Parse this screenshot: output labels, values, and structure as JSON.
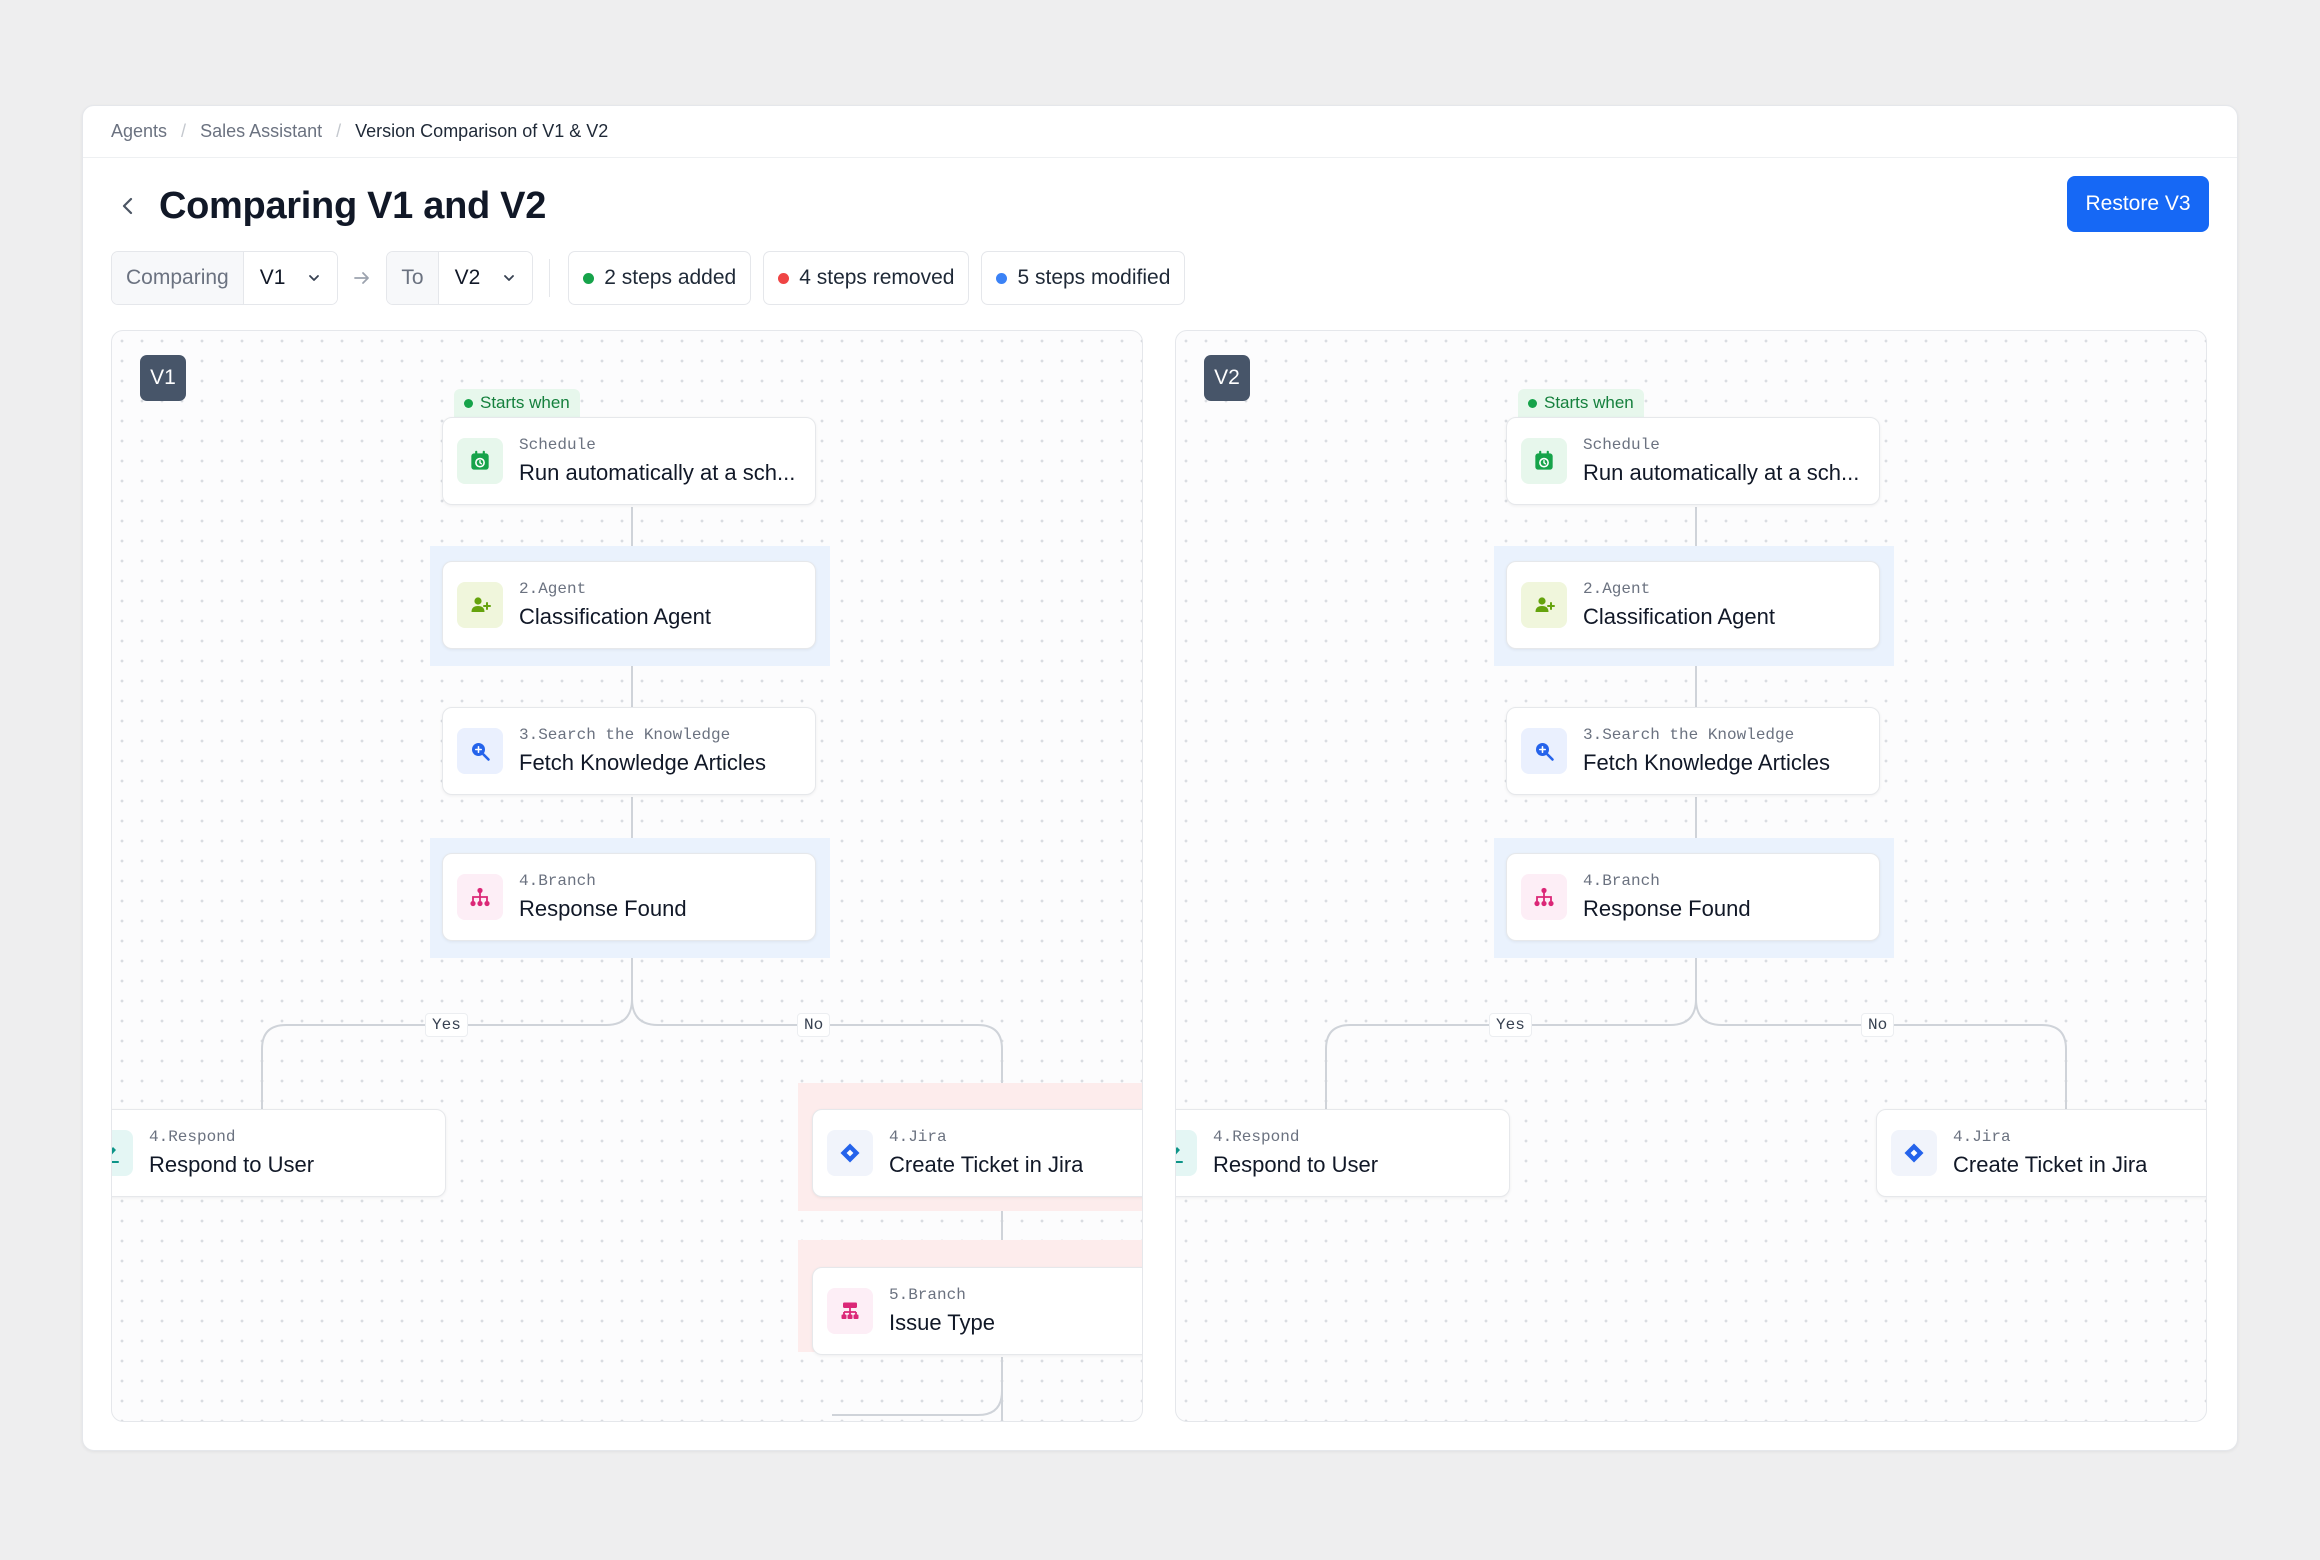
{
  "breadcrumb": {
    "items": [
      "Agents",
      "Sales Assistant",
      "Version Comparison of V1 & V2"
    ]
  },
  "header": {
    "title": "Comparing V1 and V2",
    "restore_label": "Restore V3"
  },
  "toolbar": {
    "comparing_label": "Comparing",
    "from_version": "V1",
    "to_label": "To",
    "to_version": "V2",
    "badges": [
      {
        "text": "2 steps added",
        "color": "#16a34a"
      },
      {
        "text": "4 steps removed",
        "color": "#ef4444"
      },
      {
        "text": "5 steps modified",
        "color": "#3b82f6"
      }
    ]
  },
  "colors": {
    "accent": "#1668f5",
    "added": "#16a34a",
    "removed": "#ef4444",
    "modified": "#3b82f6"
  },
  "panels": [
    {
      "version": "V1",
      "start_tag": "Starts when",
      "nodes": {
        "schedule": {
          "sub": "Schedule",
          "main": "Run automatically at a sch..."
        },
        "agent": {
          "sub": "2.Agent",
          "main": "Classification Agent"
        },
        "knowledge": {
          "sub": "3.Search the Knowledge",
          "main": "Fetch Knowledge Articles"
        },
        "branch": {
          "sub": "4.Branch",
          "main": "Response Found"
        },
        "respond": {
          "sub": "4.Respond",
          "main": "Respond to User"
        },
        "jira": {
          "sub": "4.Jira",
          "main": "Create Ticket in Jira"
        },
        "issue": {
          "sub": "5.Branch",
          "main": "Issue Type"
        }
      },
      "edge_labels": {
        "yes": "Yes",
        "no": "No"
      }
    },
    {
      "version": "V2",
      "start_tag": "Starts when",
      "nodes": {
        "schedule": {
          "sub": "Schedule",
          "main": "Run automatically at a sch..."
        },
        "agent": {
          "sub": "2.Agent",
          "main": "Classification Agent"
        },
        "knowledge": {
          "sub": "3.Search the Knowledge",
          "main": "Fetch Knowledge Articles"
        },
        "branch": {
          "sub": "4.Branch",
          "main": "Response Found"
        },
        "respond": {
          "sub": "4.Respond",
          "main": "Respond to User"
        },
        "jira": {
          "sub": "4.Jira",
          "main": "Create Ticket in Jira"
        }
      },
      "edge_labels": {
        "yes": "Yes",
        "no": "No"
      }
    }
  ]
}
